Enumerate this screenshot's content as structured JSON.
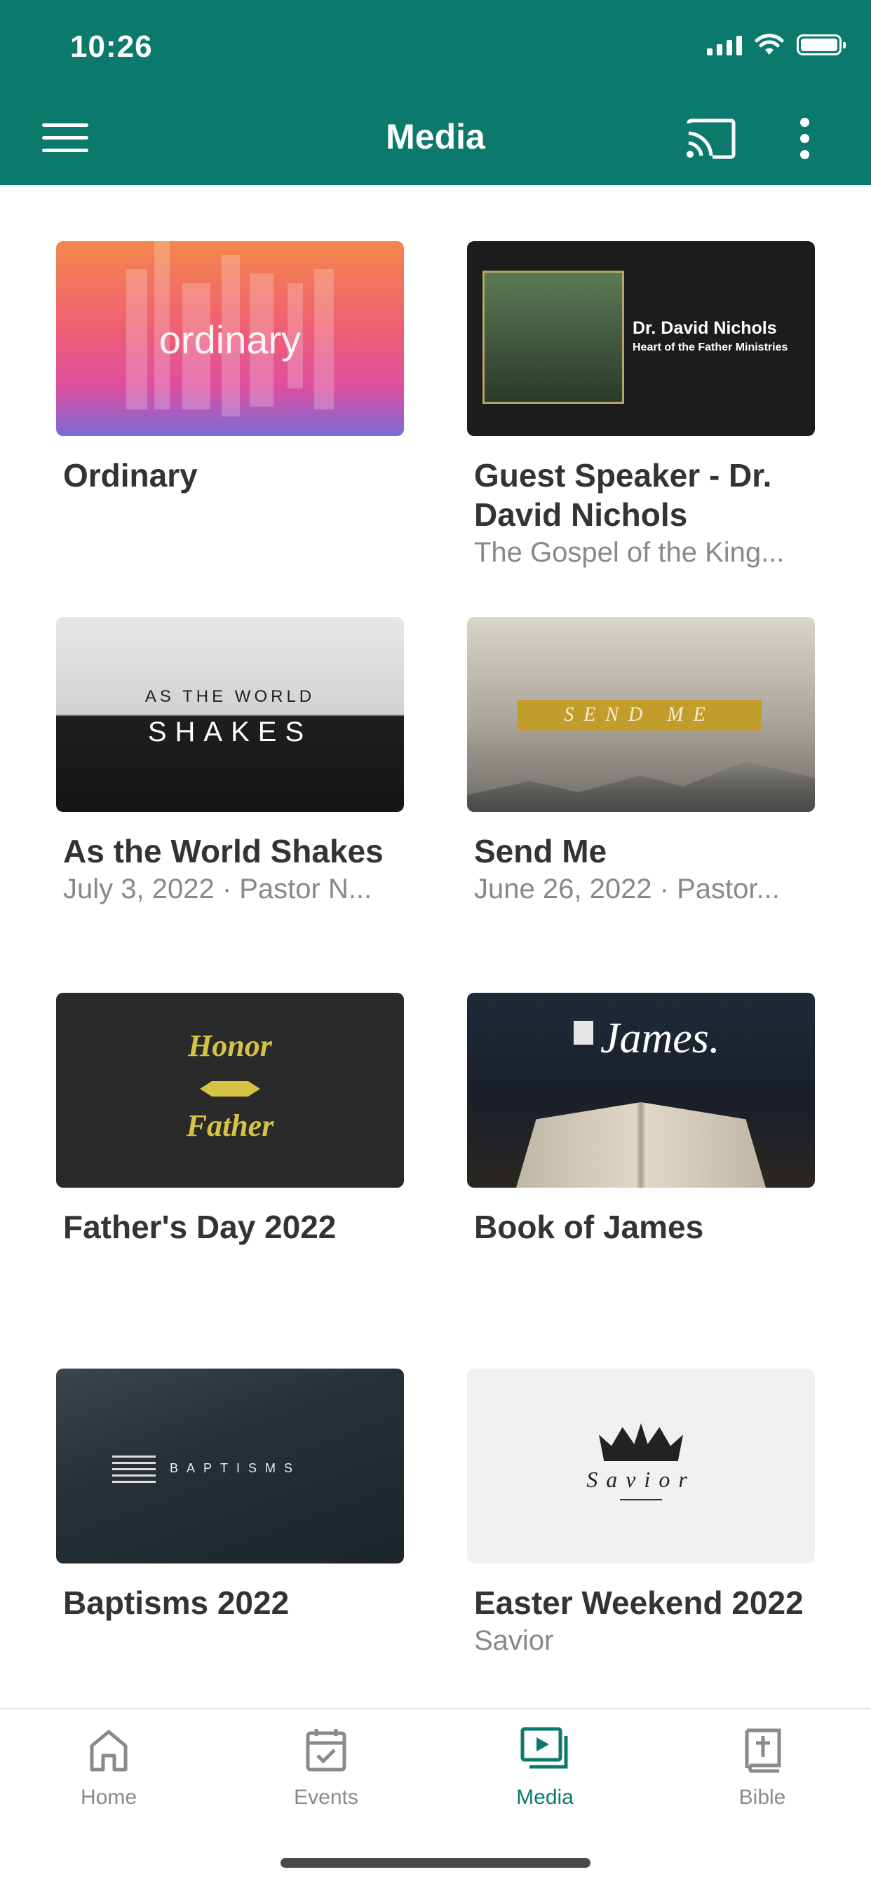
{
  "status_bar": {
    "time": "10:26"
  },
  "header": {
    "title": "Media",
    "icons": [
      "menu-icon",
      "cast-icon",
      "more-vert-icon"
    ]
  },
  "accent_color": "#0b7a6d",
  "items": [
    {
      "title": "Ordinary",
      "subtitle": "",
      "thumb_text": "ordinary"
    },
    {
      "title": "Guest Speaker - Dr. David Nichols",
      "subtitle": "The Gospel of the King...",
      "thumb_text": "Dr. David Nichols",
      "thumb_text2": "Heart of the Father Ministries"
    },
    {
      "title": "As the World Shakes",
      "subtitle": "July 3, 2022 · Pastor N...",
      "thumb_text": "AS THE WORLD",
      "thumb_text2": "SHAKES"
    },
    {
      "title": "Send Me",
      "subtitle": "June 26, 2022 · Pastor...",
      "thumb_text": "SEND ME"
    },
    {
      "title": "Father's Day 2022",
      "subtitle": "",
      "thumb_text": "Honor",
      "thumb_text2": "Father"
    },
    {
      "title": "Book of James",
      "subtitle": "",
      "thumb_text": "James."
    },
    {
      "title": "Baptisms 2022",
      "subtitle": "",
      "thumb_text": "BAPTISMS"
    },
    {
      "title": "Easter Weekend 2022",
      "subtitle": "Savior",
      "thumb_text": "Savior"
    }
  ],
  "tabs": [
    {
      "label": "Home",
      "icon": "home-icon",
      "active": false
    },
    {
      "label": "Events",
      "icon": "calendar-icon",
      "active": false
    },
    {
      "label": "Media",
      "icon": "media-icon",
      "active": true
    },
    {
      "label": "Bible",
      "icon": "bible-icon",
      "active": false
    }
  ]
}
